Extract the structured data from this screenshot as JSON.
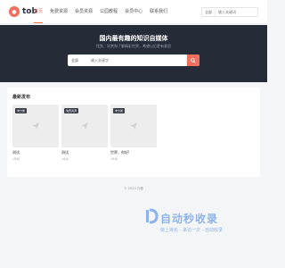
{
  "brand": {
    "logo_text": "tob"
  },
  "nav": [
    {
      "label": "首页",
      "active": true
    },
    {
      "label": "免费资源"
    },
    {
      "label": "会员资源"
    },
    {
      "label": "公园教程"
    },
    {
      "label": "会员中心"
    },
    {
      "label": "联系我们"
    }
  ],
  "top_search": {
    "scope": "全部",
    "placeholder": "输入关键词"
  },
  "hero": {
    "title": "国内最有趣的知识自媒体",
    "subtitle": "找到、欣赏和了解精彩世界，希望以后更有意思",
    "search_scope": "全部",
    "search_placeholder": "输入关键字"
  },
  "section": {
    "title": "最新发布"
  },
  "cards": [
    {
      "tag": "未分类",
      "title": "测试",
      "meta": "1年前"
    },
    {
      "tag": "免费资源",
      "title": "测试",
      "meta": "1年前"
    },
    {
      "tag": "未分类",
      "title": "世界，你好!",
      "meta": "1年前"
    }
  ],
  "footer": {
    "text": "© 2023 万格"
  },
  "watermark": {
    "text": "自动秒收录",
    "sub": "做上排名 - 来访一次 - 自动收录"
  },
  "colors": {
    "accent": "#f26d5b",
    "hero_bg": "#262b38",
    "watermark": "#8db3ee"
  }
}
